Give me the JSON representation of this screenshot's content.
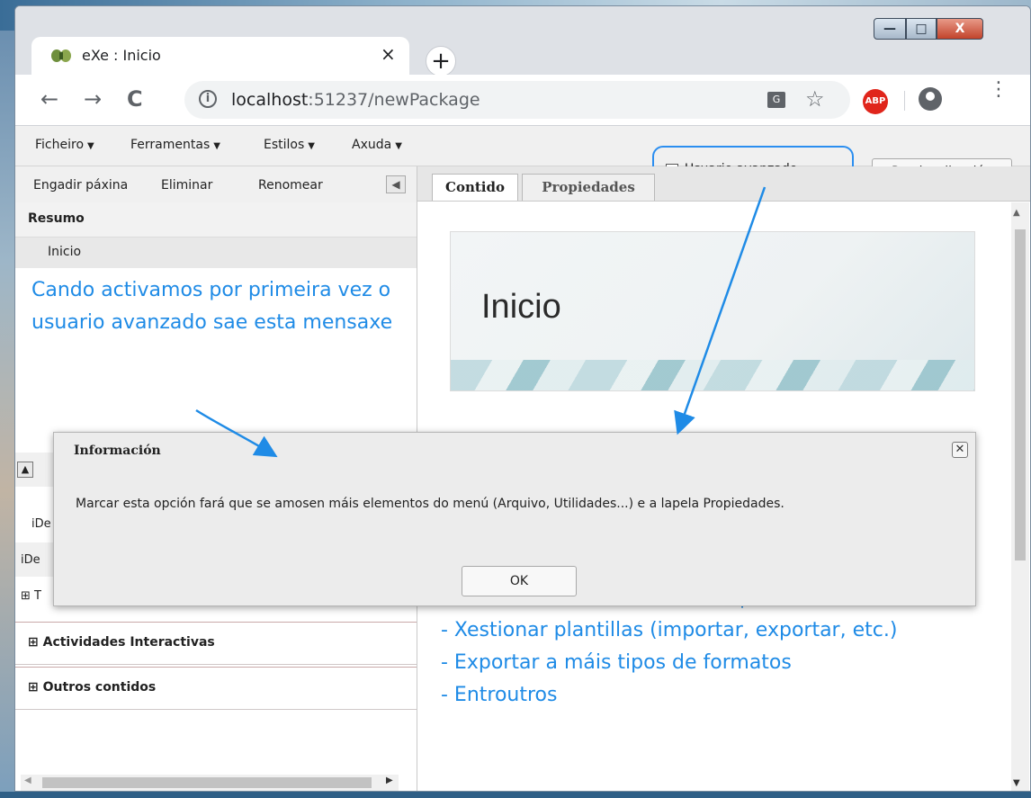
{
  "browser": {
    "tab_title": "eXe : Inicio",
    "tab_close": "×",
    "new_tab": "+",
    "url_host": "localhost",
    "url_rest": ":51237/newPackage",
    "abp_label": "ABP",
    "window_buttons": {
      "minimize": "—",
      "maximize": "□",
      "close": "X"
    }
  },
  "menubar": {
    "items": [
      "Ficheiro",
      "Ferramentas",
      "Estilos",
      "Axuda"
    ],
    "advanced_user_label": "Usuario avanzado",
    "advanced_user_checked": true,
    "preview_button": "Previsualización"
  },
  "left_panel": {
    "toolbar": [
      "Engadir páxina",
      "Eliminar",
      "Renomear"
    ],
    "outline_header": "Resumo",
    "outline_node": "Inicio",
    "callout_text": "Cando activamos por primeira vez o usuario avanzado sae esta mensaxe",
    "partial_row_1": "iDe",
    "partial_row_2": "iDe",
    "partial_row_3": "⊞ T",
    "sections": [
      "⊞ Actividades Interactivas",
      "⊞ Outros contidos"
    ]
  },
  "right_panel": {
    "tabs": [
      "Contido",
      "Propiedades"
    ],
    "banner_title": "Inicio",
    "callout_lines": [
      "O check de usuario avanzado permite:",
      "- Xestionar plantillas (importar, exportar, etc.)",
      "- Exportar a máis tipos de formatos",
      "- Entroutros"
    ]
  },
  "dialog": {
    "title": "Información",
    "message": "Marcar esta opción fará que se amosen máis elementos do menú (Arquivo, Utilidades...) e a lapela Propiedades.",
    "ok_button": "OK",
    "close": "✕"
  },
  "colors": {
    "annotation": "#1f8be6",
    "abp": "#e0251b"
  }
}
